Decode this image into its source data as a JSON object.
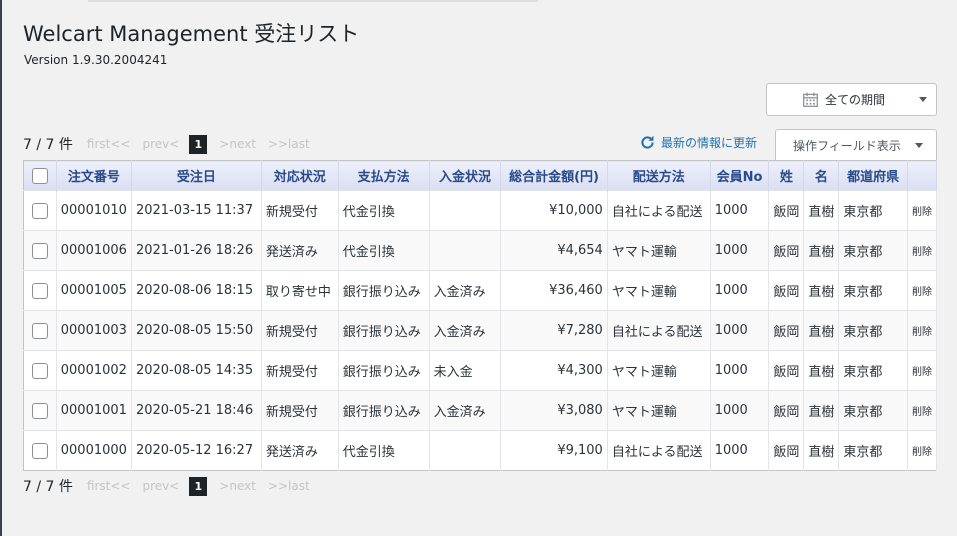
{
  "header": {
    "title": "Welcart Management 受注リスト",
    "version": "Version 1.9.30.2004241"
  },
  "period_filter": {
    "value": "全ての期間",
    "icon": "calendar-icon"
  },
  "pagination": {
    "count": "7 / 7 件",
    "first": "first<<",
    "prev": "prev<",
    "current": "1",
    "next": ">next",
    "last": ">>last"
  },
  "refresh_link": {
    "label": "最新の情報に更新",
    "icon": "refresh-icon"
  },
  "field_button": {
    "label": "操作フィールド表示"
  },
  "table": {
    "columns": [
      "注文番号",
      "受注日",
      "対応状況",
      "支払方法",
      "入金状況",
      "総合計金額(円)",
      "配送方法",
      "会員No",
      "姓",
      "名",
      "都道府県"
    ],
    "rows": [
      {
        "id": "00001010",
        "date": "2021-03-15 11:37",
        "status": "新規受付",
        "payment": "代金引換",
        "paid": "",
        "total": "¥10,000",
        "delivery": "自社による配送",
        "member": "1000",
        "last": "飯岡",
        "first": "直樹",
        "pref": "東京都",
        "delete": "削除"
      },
      {
        "id": "00001006",
        "date": "2021-01-26 18:26",
        "status": "発送済み",
        "payment": "代金引換",
        "paid": "",
        "total": "¥4,654",
        "delivery": "ヤマト運輸",
        "member": "1000",
        "last": "飯岡",
        "first": "直樹",
        "pref": "東京都",
        "delete": "削除"
      },
      {
        "id": "00001005",
        "date": "2020-08-06 18:15",
        "status": "取り寄せ中",
        "payment": "銀行振り込み",
        "paid": "入金済み",
        "total": "¥36,460",
        "delivery": "ヤマト運輸",
        "member": "1000",
        "last": "飯岡",
        "first": "直樹",
        "pref": "東京都",
        "delete": "削除"
      },
      {
        "id": "00001003",
        "date": "2020-08-05 15:50",
        "status": "新規受付",
        "payment": "銀行振り込み",
        "paid": "入金済み",
        "total": "¥7,280",
        "delivery": "自社による配送",
        "member": "1000",
        "last": "飯岡",
        "first": "直樹",
        "pref": "東京都",
        "delete": "削除"
      },
      {
        "id": "00001002",
        "date": "2020-08-05 14:35",
        "status": "新規受付",
        "payment": "銀行振り込み",
        "paid": "未入金",
        "total": "¥4,300",
        "delivery": "ヤマト運輸",
        "member": "1000",
        "last": "飯岡",
        "first": "直樹",
        "pref": "東京都",
        "delete": "削除"
      },
      {
        "id": "00001001",
        "date": "2020-05-21 18:46",
        "status": "新規受付",
        "payment": "銀行振り込み",
        "paid": "入金済み",
        "total": "¥3,080",
        "delivery": "ヤマト運輸",
        "member": "1000",
        "last": "飯岡",
        "first": "直樹",
        "pref": "東京都",
        "delete": "削除"
      },
      {
        "id": "00001000",
        "date": "2020-05-12 16:27",
        "status": "発送済み",
        "payment": "代金引換",
        "paid": "",
        "total": "¥9,100",
        "delivery": "自社による配送",
        "member": "1000",
        "last": "飯岡",
        "first": "直樹",
        "pref": "東京都",
        "delete": "削除"
      }
    ]
  },
  "colors": {
    "link": "#2271b1",
    "green_status": "#00a32a",
    "red_status": "#d63638",
    "header_text": "#2a4a8a"
  }
}
